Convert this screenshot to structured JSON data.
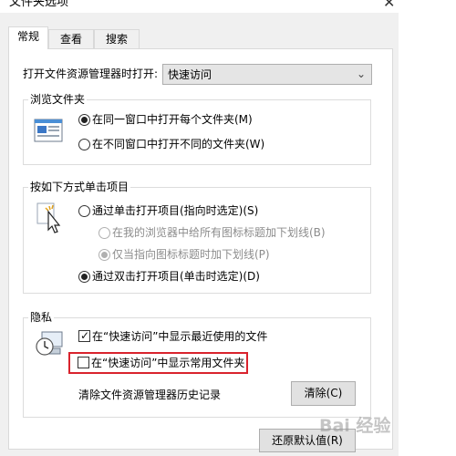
{
  "window": {
    "title": "文件夹选项",
    "close_glyph": "✕"
  },
  "tabs": [
    {
      "label": "常规",
      "active": true
    },
    {
      "label": "查看",
      "active": false
    },
    {
      "label": "搜索",
      "active": false
    }
  ],
  "open_explorer": {
    "label": "打开文件资源管理器时打开:",
    "selected": "快速访问",
    "dropdown_glyph": "⌄"
  },
  "browse_folders": {
    "title": "浏览文件夹",
    "options": [
      {
        "label": "在同一窗口中打开每个文件夹(M)",
        "checked": true
      },
      {
        "label": "在不同窗口中打开不同的文件夹(W)",
        "checked": false
      }
    ]
  },
  "click_items": {
    "title": "按如下方式单击项目",
    "single_click": {
      "label": "通过单击打开项目(指向时选定)(S)",
      "checked": false
    },
    "underline_all": {
      "label": "在我的浏览器中给所有图标标题加下划线(B)",
      "checked": false,
      "disabled": true
    },
    "underline_hover": {
      "label": "仅当指向图标标题时加下划线(P)",
      "checked": true,
      "disabled": true
    },
    "double_click": {
      "label": "通过双击打开项目(单击时选定)(D)",
      "checked": true
    }
  },
  "privacy": {
    "title": "隐私",
    "show_recent": {
      "label": "在“快速访问”中显示最近使用的文件",
      "checked": true,
      "check_glyph": "✓"
    },
    "show_frequent": {
      "label": "在“快速访问”中显示常用文件夹",
      "checked": false
    },
    "clear_label": "清除文件资源管理器历史记录",
    "clear_button": "清除(C)"
  },
  "restore_button": "还原默认值(R)",
  "watermark": "Bai 经验",
  "colors": {
    "highlight_border": "#d9232d",
    "panel_bg": "#ffffff",
    "dialog_bg": "#f0f0f0"
  }
}
